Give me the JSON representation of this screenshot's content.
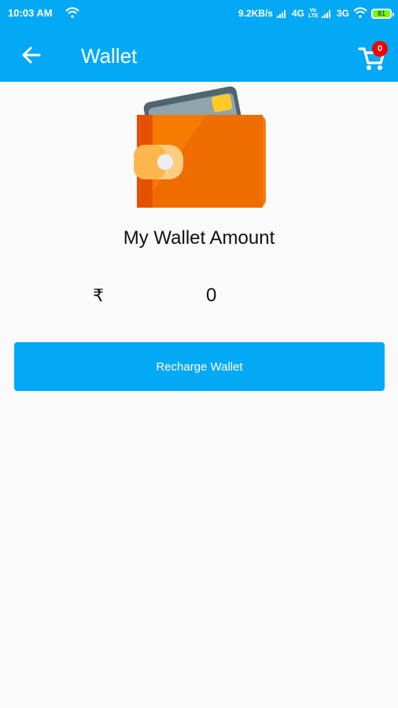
{
  "status_bar": {
    "time": "10:03 AM",
    "net_speed": "9.2KB/s",
    "network_4g": "4G",
    "volte_top": "Vo",
    "volte_bottom": "LTE",
    "network_3g": "3G",
    "battery": "81"
  },
  "app_bar": {
    "title": "Wallet",
    "back_icon": "arrow-back-icon",
    "cart_icon": "shopping-cart-icon",
    "cart_count": "0"
  },
  "wallet": {
    "illustration": "wallet-icon",
    "heading": "My Wallet Amount",
    "currency_symbol": "₹",
    "amount": "0"
  },
  "actions": {
    "recharge_label": "Recharge Wallet"
  },
  "colors": {
    "primary": "#03a9f4",
    "badge": "#f50000",
    "background": "#fafafa",
    "wallet_orange": "#f57c00"
  }
}
